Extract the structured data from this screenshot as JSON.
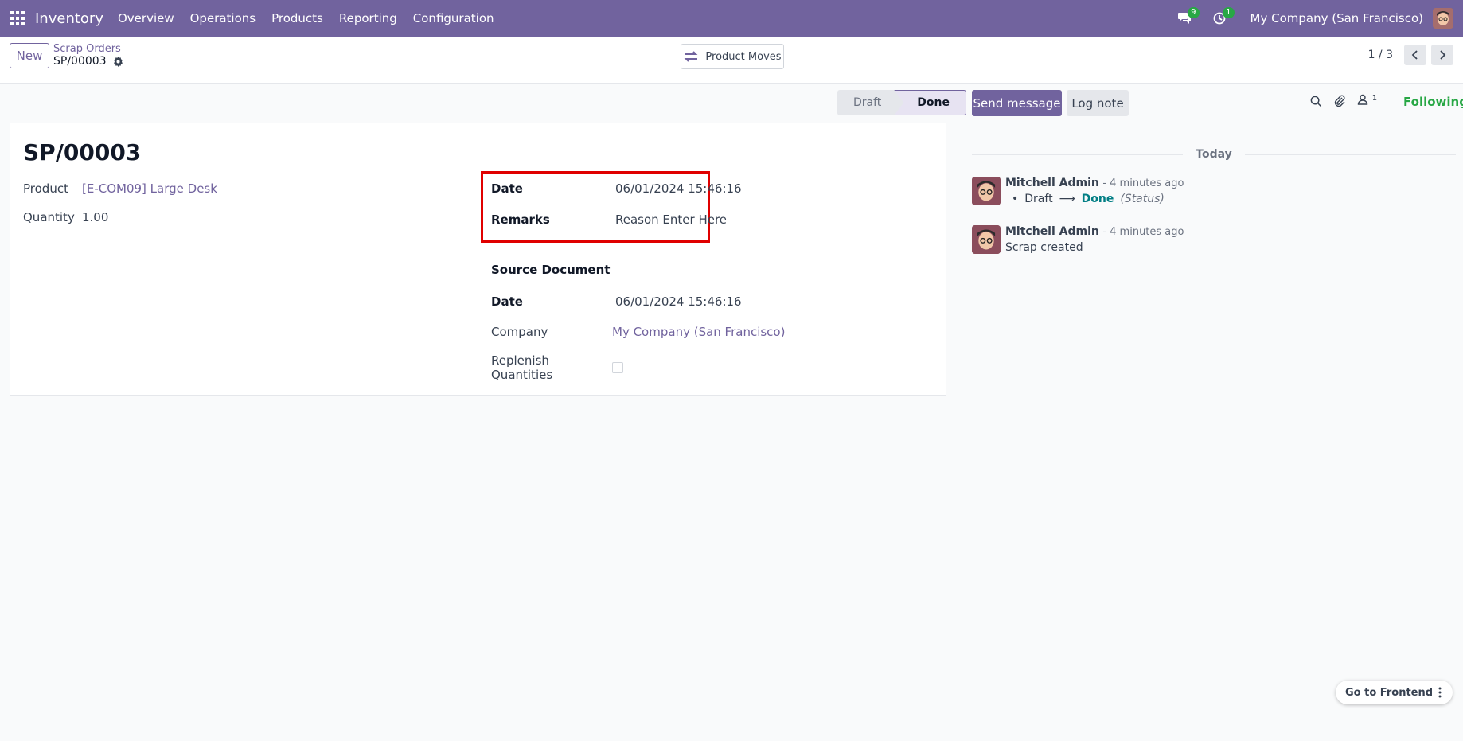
{
  "navbar": {
    "brand": "Inventory",
    "menu": [
      "Overview",
      "Operations",
      "Products",
      "Reporting",
      "Configuration"
    ],
    "messages_count": "9",
    "activities_count": "1",
    "company": "My Company (San Francisco)"
  },
  "control_panel": {
    "new_label": "New",
    "breadcrumb_parent": "Scrap Orders",
    "breadcrumb_current": "SP/00003",
    "product_moves_label": "Product Moves",
    "pager_value": "1 / 3"
  },
  "statusbar": {
    "stages": [
      "Draft",
      "Done"
    ],
    "current": "Done"
  },
  "form": {
    "title": "SP/00003",
    "product_label": "Product",
    "product_value": "[E-COM09] Large Desk",
    "quantity_label": "Quantity",
    "quantity_value": "1.00",
    "date_label": "Date",
    "date_value": "06/01/2024 15:46:16",
    "remarks_label": "Remarks",
    "remarks_value": "Reason Enter Here",
    "source_document_label": "Source Document",
    "date2_label": "Date",
    "date2_value": "06/01/2024 15:46:16",
    "company_label": "Company",
    "company_value": "My Company (San Francisco)",
    "replenish_label": "Replenish Quantities",
    "replenish_checked": false
  },
  "chatter": {
    "send_message_label": "Send message",
    "log_note_label": "Log note",
    "followers_count": "1",
    "following_label": "Following",
    "today_label": "Today",
    "messages": [
      {
        "author": "Mitchell Admin",
        "time": "- 4 minutes ago",
        "tracking_old": "Draft",
        "tracking_new": "Done",
        "tracking_field": "(Status)"
      },
      {
        "author": "Mitchell Admin",
        "time": "- 4 minutes ago",
        "text": "Scrap created"
      }
    ]
  },
  "footer": {
    "go_to_frontend_label": "Go to Frontend"
  },
  "colors": {
    "brand": "#71639e",
    "success": "#28a745",
    "highlight": "#e00000",
    "link_teal": "#017e84"
  }
}
